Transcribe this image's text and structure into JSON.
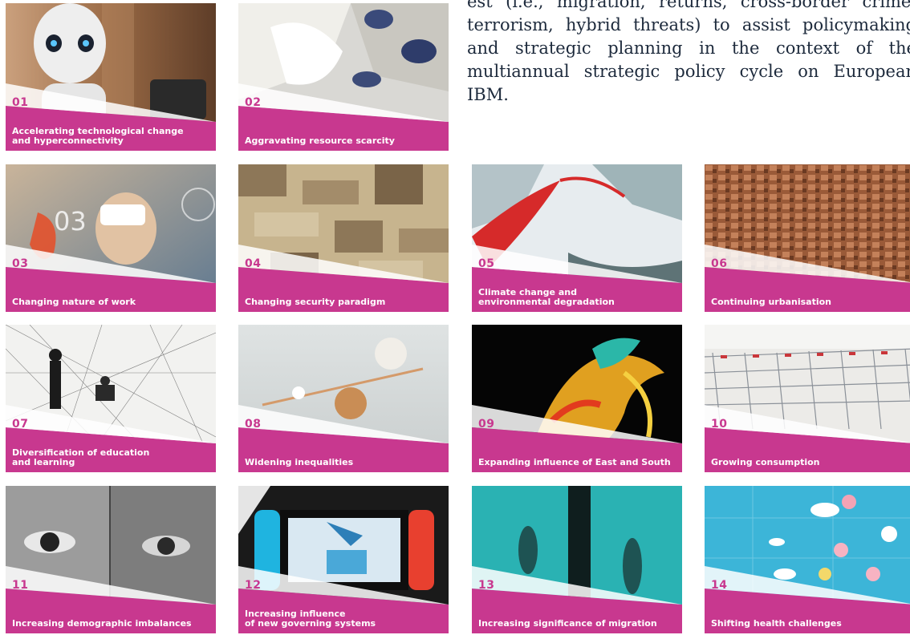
{
  "intro_text": "est (i.e., migration, returns, cross-border crime, terrorism, hybrid threats) to assist policymaking and strategic planning in the context of the multiannual strategic policy cycle on European IBM.",
  "accent_color": "#c8388f",
  "tiles": [
    {
      "num": "01",
      "label": "Accelerating technological change\nand hyperconnectivity",
      "image": "humanoid robot"
    },
    {
      "num": "02",
      "label": "Aggravating resource scarcity",
      "image": "white mineral rock"
    },
    {
      "num": "03",
      "label": "Changing nature of work",
      "image": "person wearing VR headset",
      "overlay_text": "03"
    },
    {
      "num": "04",
      "label": "Changing security paradigm",
      "image": "desert camouflage pattern"
    },
    {
      "num": "05",
      "label": "Climate change and\nenvironmental degradation",
      "image": "aerial view of glacier and red river"
    },
    {
      "num": "06",
      "label": "Continuing urbanisation",
      "image": "dense city rooftops"
    },
    {
      "num": "07",
      "label": "Diversification of education\nand learning",
      "image": "people in string web"
    },
    {
      "num": "08",
      "label": "Widening inequalities",
      "image": "balance plank with spheres"
    },
    {
      "num": "09",
      "label": "Expanding influence of East and South",
      "image": "illuminated dragon lantern"
    },
    {
      "num": "10",
      "label": "Growing consumption",
      "image": "rows of shopping carts"
    },
    {
      "num": "11",
      "label": "Increasing demographic imbalances",
      "image": "young and old eyes"
    },
    {
      "num": "12",
      "label": "Increasing influence\nof new governing systems",
      "image": "hands holding game console with vote"
    },
    {
      "num": "13",
      "label": "Increasing significance of migration",
      "image": "silhouettes behind frosted glass"
    },
    {
      "num": "14",
      "label": "Shifting health challenges",
      "image": "pills on circuit board"
    }
  ]
}
